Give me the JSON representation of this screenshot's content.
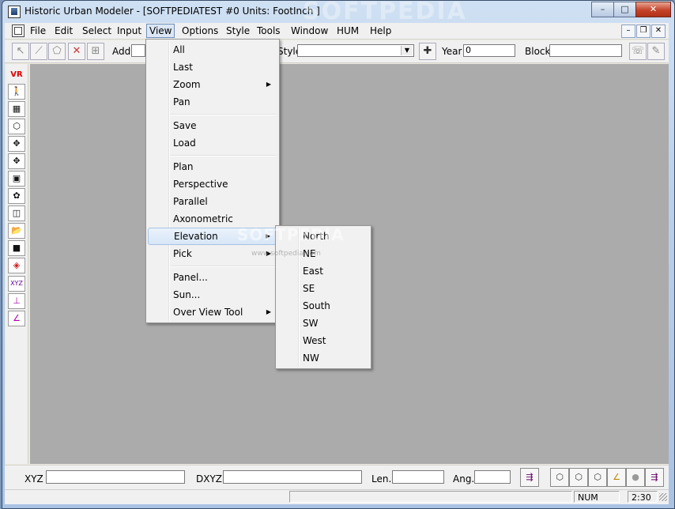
{
  "app": {
    "title": "Historic Urban Modeler - [SOFTPEDIATEST #0  Units: FootInch ]",
    "watermark": "SOFTPEDIA"
  },
  "caption": {
    "minimize": "–",
    "maximize": "□",
    "close": "✕"
  },
  "menubar": {
    "items": [
      "File",
      "Edit",
      "Select",
      "Input",
      "View",
      "Options",
      "Style",
      "Tools",
      "Window",
      "HUM",
      "Help"
    ],
    "mdi": {
      "minimize": "–",
      "restore": "❐",
      "close": "✕"
    }
  },
  "toolbar": {
    "add_label": "Add",
    "style_label": "Style",
    "year_label": "Year",
    "year_value": "0",
    "block_label": "Block",
    "block_value": "",
    "style_value": ""
  },
  "left_tools": [
    "VR",
    "walk-icon",
    "grid-icon",
    "cube-icon",
    "move-icon",
    "move-all-icon",
    "copy-icon",
    "paint-icon",
    "panel-icon",
    "open-folder-icon",
    "save-icon",
    "tag-icon",
    "xyz-query-icon",
    "measure-icon",
    "angle-icon"
  ],
  "bottom": {
    "xyz_label": "XYZ",
    "dxyz_label": "DXYZ",
    "len_label": "Len.",
    "ang_label": "Ang.",
    "xyz_value": "",
    "dxyz_value": "",
    "len_value": "",
    "ang_value": ""
  },
  "status": {
    "num": "NUM",
    "time": "2:30"
  },
  "view_menu": {
    "items": [
      "All",
      "Last",
      "Zoom",
      "Pan",
      "Save",
      "Load",
      "Plan",
      "Perspective",
      "Parallel",
      "Axonometric",
      "Elevation",
      "Pick",
      "Panel...",
      "Sun...",
      "Over View Tool"
    ],
    "highlighted": "Elevation"
  },
  "elevation_menu": {
    "items": [
      "North",
      "NE",
      "East",
      "SE",
      "South",
      "SW",
      "West",
      "NW"
    ]
  },
  "canvas_watermark": {
    "big": "SOFTPEDIA",
    "small": "www.softpedia.com"
  }
}
